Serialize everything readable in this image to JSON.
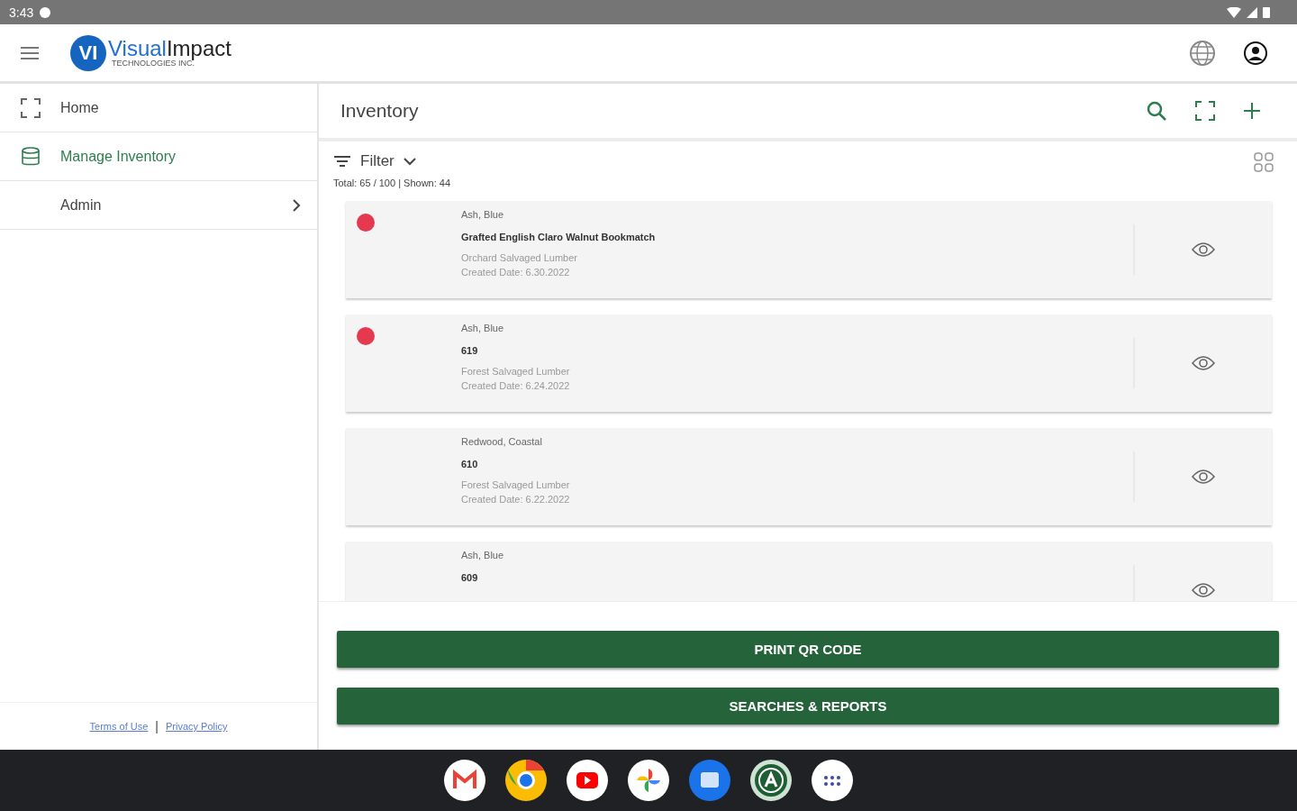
{
  "status_bar": {
    "time": "3:43"
  },
  "logo": {
    "mark": "VI",
    "word_1": "Visual",
    "word_2": "Impact",
    "tagline": "TECHNOLOGIES INC."
  },
  "sidebar": {
    "items": [
      {
        "label": "Home",
        "selected": false,
        "has_submenu": false
      },
      {
        "label": "Manage Inventory",
        "selected": true,
        "has_submenu": false
      },
      {
        "label": "Admin",
        "selected": false,
        "has_submenu": true
      }
    ],
    "links": [
      "Terms of Use",
      "Privacy Policy"
    ],
    "separator": "|"
  },
  "page": {
    "title": "Inventory",
    "filter": "Filter",
    "summary": "Total: 65 / 100 | Shown: 44"
  },
  "items": [
    {
      "flagged": true,
      "species": "Ash, Blue",
      "name": "Grafted English Claro Walnut Bookmatch",
      "source": "Orchard Salvaged Lumber",
      "created": "Created Date: 6.30.2022"
    },
    {
      "flagged": true,
      "species": "Ash, Blue",
      "name": "619",
      "source": "Forest Salvaged Lumber",
      "created": "Created Date: 6.24.2022"
    },
    {
      "flagged": false,
      "species": "Redwood, Coastal",
      "name": "610",
      "source": "Forest Salvaged Lumber",
      "created": "Created Date: 6.22.2022"
    },
    {
      "flagged": false,
      "species": "Ash, Blue",
      "name": "609"
    }
  ],
  "buttons": [
    "PRINT QR CODE",
    "SEARCHES & REPORTS"
  ]
}
